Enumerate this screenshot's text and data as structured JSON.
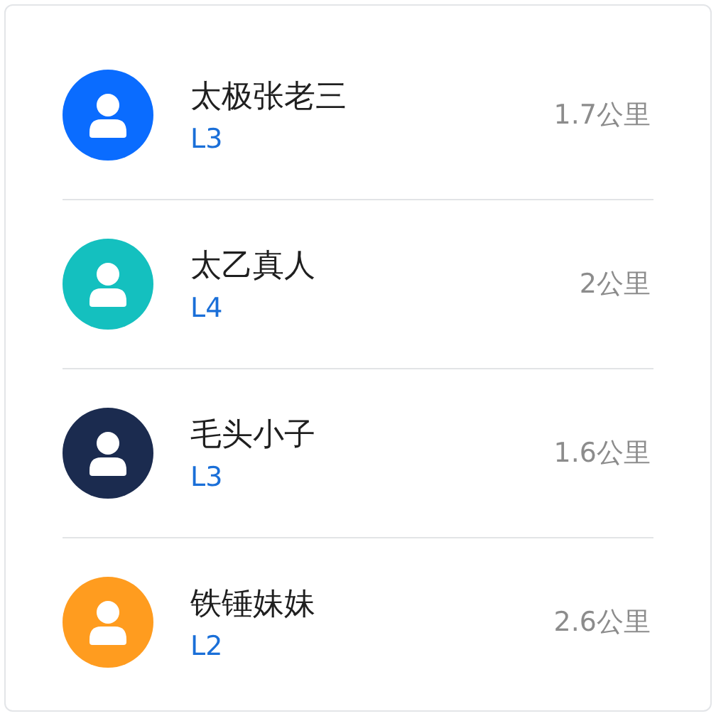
{
  "users": [
    {
      "name": "太极张老三",
      "level": "L3",
      "distance": "1.7公里",
      "color": "#0a6cff"
    },
    {
      "name": "太乙真人",
      "level": "L4",
      "distance": "2公里",
      "color": "#14c0bf"
    },
    {
      "name": "毛头小子",
      "level": "L3",
      "distance": "1.6公里",
      "color": "#1b2b4f"
    },
    {
      "name": "铁锤妹妹",
      "level": "L2",
      "distance": "2.6公里",
      "color": "#ff9c1f"
    }
  ]
}
